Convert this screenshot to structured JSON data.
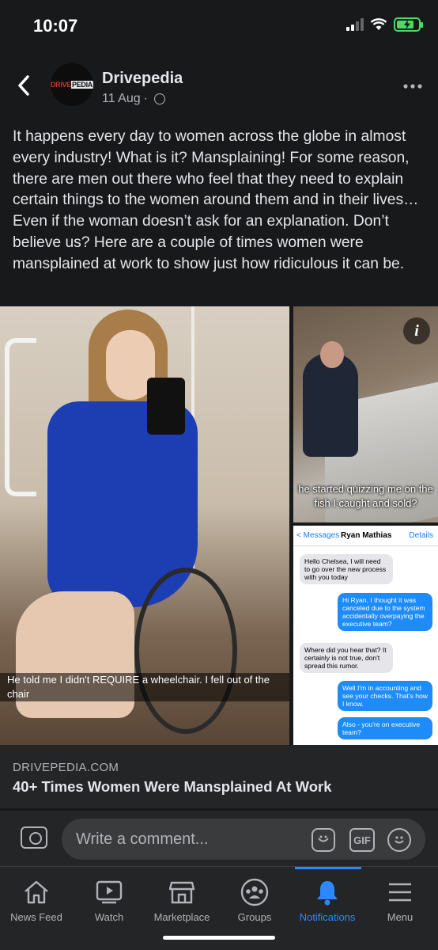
{
  "status": {
    "time": "10:07"
  },
  "post": {
    "page_name": "Drivepedia",
    "avatar_logo_a": "DRIVE",
    "avatar_logo_b": "PEDIA",
    "date": "11 Aug",
    "separator": "·",
    "text": "It happens every day to women across the globe in almost every industry! What is it? Mansplaining! For some reason, there are men out there who feel that they need to explain certain things to the women around them and in their lives… Even if the woman doesn’t ask for an explanation. Don’t believe us? Here are a couple of times women were mansplained at work to show just how ridiculous it can be."
  },
  "media": {
    "main_caption": "He told me I didn't REQUIRE a wheelchair. I fell out of the chair",
    "top_right_caption": "he started quizzing me on the fish I caught and sold?",
    "info_label": "i",
    "messages": {
      "back_label": "< Messages",
      "contact": "Ryan Mathias",
      "details_label": "Details",
      "bubbles": [
        "Hello Chelsea, I will need to go over the new process with you today",
        "Hi Ryan, I thought it was canceled due to the system accidentally overpaying the executive team?",
        "Where did you hear that? It certainly is not true, don't spread this rumor.",
        "Well I'm in accounting and see your checks. That's how I know.",
        "Also - you're on executive team?"
      ]
    }
  },
  "link_preview": {
    "domain": "DRIVEPEDIA.COM",
    "title": "40+ Times Women Were Mansplained At Work"
  },
  "comment": {
    "placeholder": "Write a comment...",
    "gif_label": "GIF"
  },
  "tabs": [
    {
      "label": "News Feed",
      "icon": "home-icon"
    },
    {
      "label": "Watch",
      "icon": "watch-icon"
    },
    {
      "label": "Marketplace",
      "icon": "marketplace-icon"
    },
    {
      "label": "Groups",
      "icon": "groups-icon"
    },
    {
      "label": "Notifications",
      "icon": "bell-icon",
      "active": true
    },
    {
      "label": "Menu",
      "icon": "menu-icon"
    }
  ],
  "colors": {
    "accent": "#2d88ff",
    "background": "#18191a",
    "surface": "#242526",
    "battery": "#4cd964"
  },
  "battery_level": 0.8
}
